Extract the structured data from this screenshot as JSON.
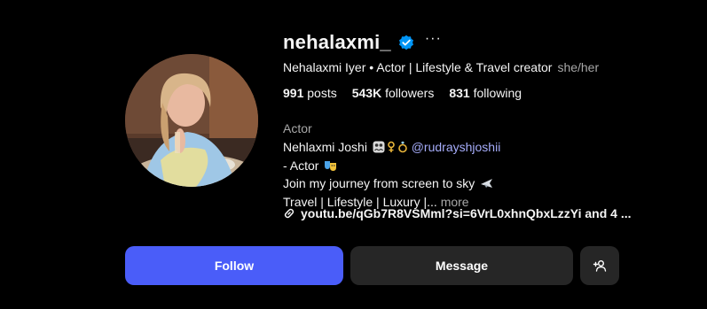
{
  "profile": {
    "username": "nehalaxmi_",
    "more_label": "···",
    "full_name_line": "Nehalaxmi Iyer • Actor | Lifestyle & Travel creator",
    "pronouns": "she/her",
    "stats": {
      "posts_count": "991",
      "posts_label": "posts",
      "followers_count": "543K",
      "followers_label": "followers",
      "following_count": "831",
      "following_label": "following"
    },
    "category": "Actor",
    "bio": {
      "line1_text": "Nehlaxmi Joshi",
      "line1_mention": "@rudrayshjoshii",
      "line2_text": "- Actor",
      "line3_text": "Join my journey from screen to sky",
      "line4_text": "Travel | Lifestyle | Luxury |...",
      "more_label": "more"
    },
    "link": "youtu.be/qGb7R8VSMml?si=6VrL0xhnQbxLzzYi and 4 ..."
  },
  "actions": {
    "follow_label": "Follow",
    "message_label": "Message"
  },
  "colors": {
    "background": "#000000",
    "follow_button": "#4a5df9",
    "secondary_button": "#262626",
    "verified_badge": "#0095f6",
    "mention": "#a6adfb"
  },
  "icons": [
    "verified-badge-icon",
    "more-options-icon",
    "couple-emoji-icon",
    "ring-emoji-icon",
    "theater-masks-emoji-icon",
    "airplane-emoji-icon",
    "link-icon",
    "add-person-icon"
  ]
}
